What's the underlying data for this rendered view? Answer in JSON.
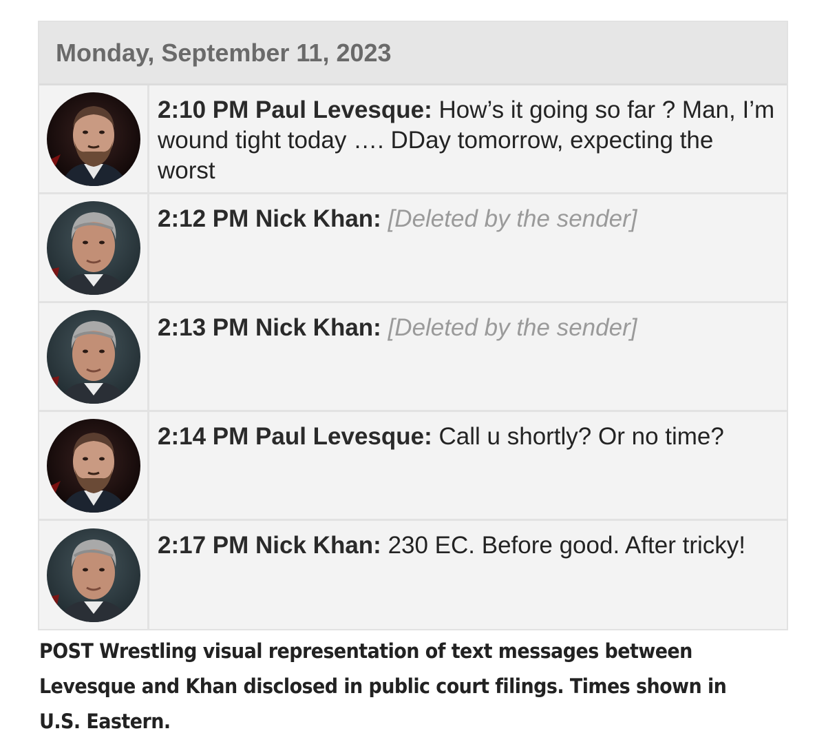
{
  "date_header": "Monday, September 11, 2023",
  "messages": [
    {
      "time": "2:10 PM",
      "sender": "Paul Levesque:",
      "text": "How’s it going so far ? Man, I’m wound tight today …. DDay tomorrow, expecting the worst",
      "deleted": false,
      "avatar": "paul-levesque-avatar"
    },
    {
      "time": "2:12 PM",
      "sender": "Nick Khan:",
      "text": "[Deleted by the sender]",
      "deleted": true,
      "avatar": "nick-khan-avatar"
    },
    {
      "time": "2:13 PM",
      "sender": "Nick Khan:",
      "text": "[Deleted by the sender]",
      "deleted": true,
      "avatar": "nick-khan-avatar"
    },
    {
      "time": "2:14 PM",
      "sender": "Paul Levesque:",
      "text": "Call u shortly? Or no time?",
      "deleted": false,
      "avatar": "paul-levesque-avatar"
    },
    {
      "time": "2:17 PM",
      "sender": "Nick Khan:",
      "text": "230 EC. Before good. After tricky!",
      "deleted": false,
      "avatar": "nick-khan-avatar"
    }
  ],
  "caption": "POST Wrestling visual representation of text messages between Levesque and Khan disclosed in public court filings. Times shown in U.S. Eastern.",
  "colors": {
    "header_bg": "#e6e6e6",
    "row_bg": "#f3f3f3",
    "deleted_text": "#9a9a9a",
    "text": "#232323"
  }
}
